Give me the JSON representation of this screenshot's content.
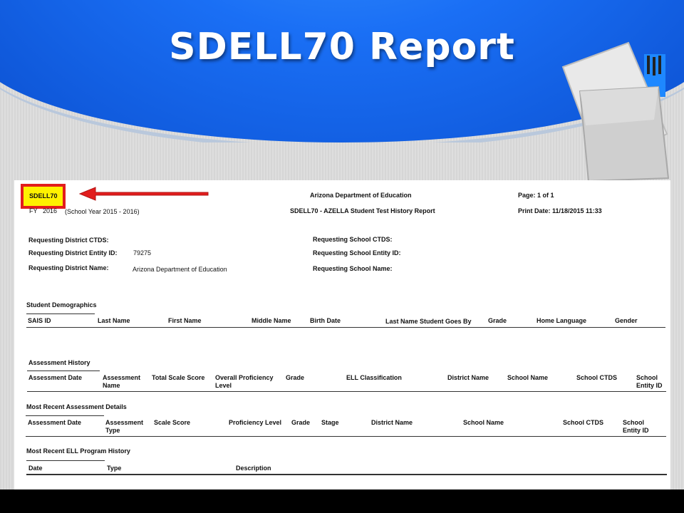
{
  "slide": {
    "title": "SDELL70 Report"
  },
  "report": {
    "code": "SDELL70",
    "fy_label": "FY",
    "fy_value": "2016",
    "school_year": "(School Year  2015 - 2016)",
    "org_title": "Arizona Department of Education",
    "report_title": "SDELL70  -  AZELLA Student Test History  Report",
    "page": "Page: 1 of 1",
    "print_date": "Print Date: 11/18/2015 11:33",
    "req": {
      "district_ctds_label": "Requesting District CTDS:",
      "district_entity_label": "Requesting District Entity ID:",
      "district_entity_value": "79275",
      "district_name_label": "Requesting District Name:",
      "district_name_value": "Arizona Department of Education",
      "school_ctds_label": "Requesting School CTDS:",
      "school_entity_label": "Requesting School Entity ID:",
      "school_name_label": "Requesting School Name:"
    },
    "demographics": {
      "heading": "Student Demographics",
      "columns": [
        "SAIS ID",
        "Last Name",
        "First Name",
        "Middle Name",
        "Birth Date",
        "Last Name Student Goes By",
        "Grade",
        "Home Language",
        "Gender"
      ]
    },
    "assessment_history": {
      "heading": "Assessment History",
      "columns": [
        "Assessment Date",
        "Assessment Name",
        "Total Scale Score",
        "Overall Proficiency Level",
        "Grade",
        "ELL Classification",
        "District Name",
        "School Name",
        "School CTDS",
        "School Entity ID"
      ]
    },
    "recent_assessment": {
      "heading": "Most Recent Assessment Details",
      "columns": [
        "Assessment Date",
        "Assessment Type",
        "Scale Score",
        "Proficiency Level",
        "Grade",
        "Stage",
        "District Name",
        "School Name",
        "School CTDS",
        "School Entity ID"
      ]
    },
    "ell_history": {
      "heading": "Most Recent ELL Program History",
      "columns": [
        "Date",
        "Type",
        "Description"
      ]
    }
  },
  "colors": {
    "banner": "#1a6ff5",
    "highlight": "#fff200",
    "arrow": "#e21d1d"
  },
  "icons": [
    "paper-clipboard-icon",
    "red-arrow-icon"
  ]
}
